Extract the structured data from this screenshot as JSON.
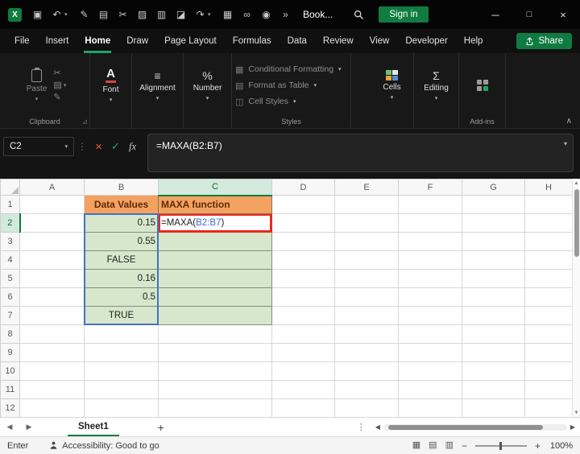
{
  "colors": {
    "accent_green": "#107C41",
    "tab_underline_green": "#21A366",
    "annotation_red": "#E8291D",
    "reference_blue": "#4472C4",
    "header_fill_orange": "#F4A261",
    "data_fill_green": "#D6E7CB"
  },
  "titlebar": {
    "app_logo_letter": "X",
    "doc_title": "Book...",
    "signin_label": "Sign in",
    "qat_icons": [
      "save-icon",
      "undo-icon",
      "pen-icon",
      "copy-icon",
      "cut-icon",
      "picture-icon",
      "chart-icon",
      "fill-color-icon",
      "redo-icon",
      "table-icon",
      "link-icon",
      "camera-icon",
      "overflow-icon",
      "search-icon"
    ]
  },
  "ribbon_tabs": {
    "items": [
      "File",
      "Insert",
      "Home",
      "Draw",
      "Page Layout",
      "Formulas",
      "Data",
      "Review",
      "View",
      "Developer",
      "Help"
    ],
    "active": "Home",
    "share_label": "Share"
  },
  "ribbon": {
    "paste_label": "Paste",
    "clipboard_group_label": "Clipboard",
    "font_label": "Font",
    "alignment_label": "Alignment",
    "number_label": "Number",
    "conditional_formatting_label": "Conditional Formatting",
    "format_as_table_label": "Format as Table",
    "cell_styles_label": "Cell Styles",
    "styles_group_label": "Styles",
    "cells_label": "Cells",
    "editing_label": "Editing",
    "addins_group_label": "Add-ins"
  },
  "formula_bar": {
    "name_box": "C2",
    "fx_label": "fx",
    "formula": "=MAXA(B2:B7)"
  },
  "grid": {
    "col_headers": [
      "A",
      "B",
      "C",
      "D",
      "E",
      "F",
      "G",
      "H"
    ],
    "row_headers": [
      "1",
      "2",
      "3",
      "4",
      "5",
      "6",
      "7",
      "8",
      "9",
      "10",
      "11",
      "12"
    ],
    "cells": {
      "B1": "Data Values",
      "C1": "MAXA function",
      "B2": "0.15",
      "B3": "0.55",
      "B4": "FALSE",
      "B5": "0.16",
      "B6": "0.5",
      "B7": "TRUE",
      "C2_prefix": "=MAXA(",
      "C2_ref": "B2:B7",
      "C2_suffix": ")"
    }
  },
  "sheet_bar": {
    "sheet_name": "Sheet1"
  },
  "status_bar": {
    "mode": "Enter",
    "accessibility": "Accessibility: Good to go",
    "zoom": "100%"
  }
}
